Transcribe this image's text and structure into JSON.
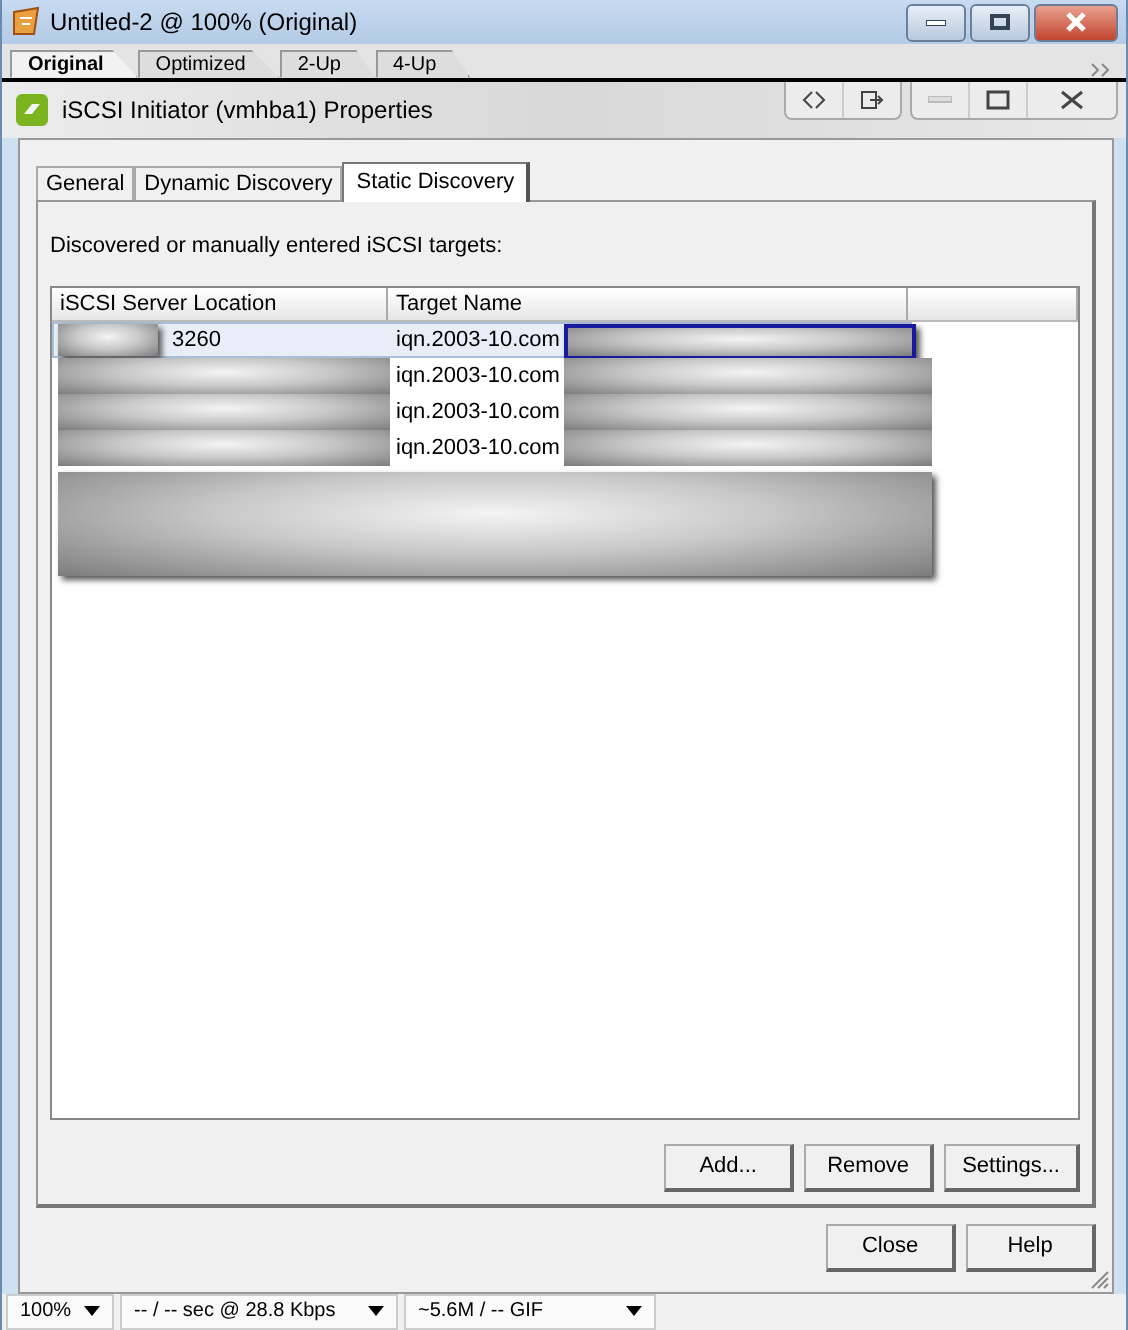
{
  "window": {
    "title": "Untitled-2 @ 100% (Original)"
  },
  "view_tabs": [
    {
      "label": "Original",
      "selected": true
    },
    {
      "label": "Optimized",
      "selected": false
    },
    {
      "label": "2-Up",
      "selected": false
    },
    {
      "label": "4-Up",
      "selected": false
    }
  ],
  "dialog": {
    "title": "iSCSI Initiator (vmhba1) Properties",
    "tabs": [
      {
        "label": "General",
        "selected": false
      },
      {
        "label": "Dynamic Discovery",
        "selected": false
      },
      {
        "label": "Static Discovery",
        "selected": true
      }
    ],
    "caption": "Discovered or manually entered iSCSI targets:",
    "table": {
      "columns": [
        "iSCSI Server Location",
        "Target Name"
      ],
      "rows": [
        {
          "location": "3260",
          "target": "iqn.2003-10.com",
          "selected": true
        },
        {
          "target": "iqn.2003-10.com",
          "selected": false
        },
        {
          "target": "iqn.2003-10.com",
          "selected": false
        },
        {
          "target": "iqn.2003-10.com",
          "selected": false
        }
      ]
    },
    "table_buttons": [
      "Add...",
      "Remove",
      "Settings..."
    ],
    "buttons": [
      "Close",
      "Help"
    ]
  },
  "status_bar": [
    "100%",
    "-- / -- sec @ 28.8 Kbps",
    "~5.6M / -- GIF"
  ]
}
